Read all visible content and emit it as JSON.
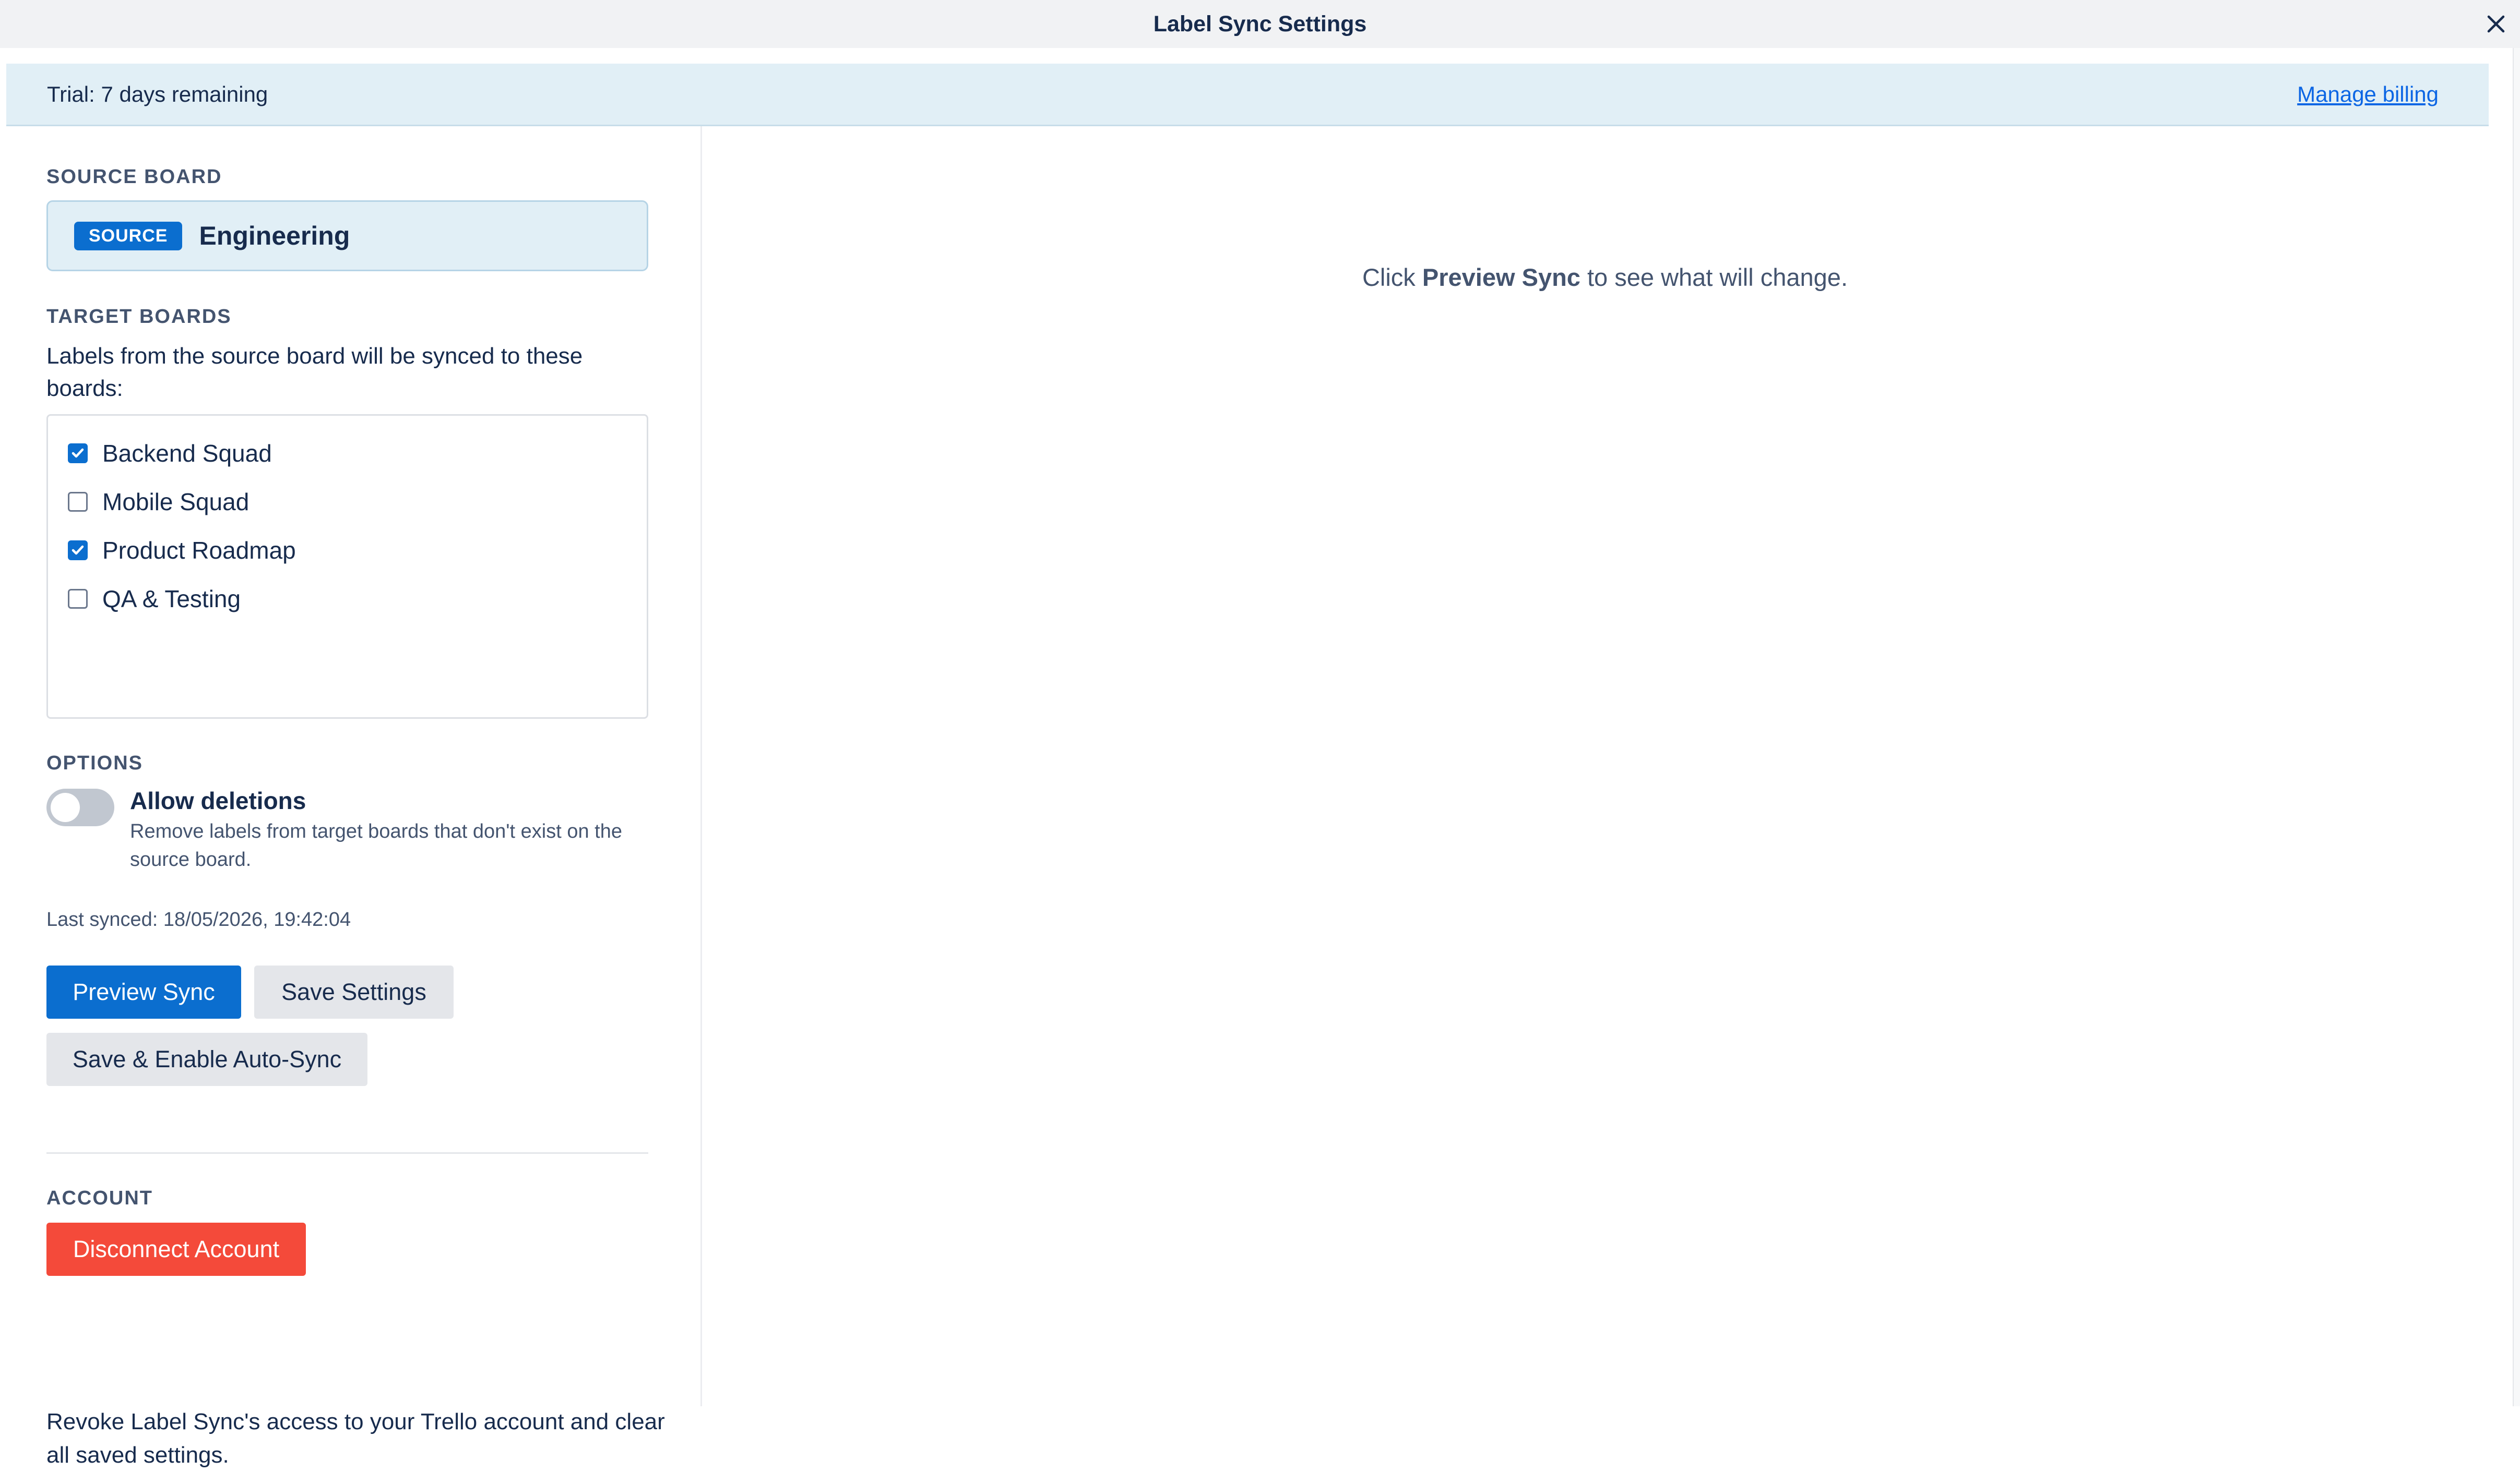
{
  "window": {
    "title": "Label Sync Settings",
    "close_icon": "close-icon"
  },
  "trial_banner": {
    "text": "Trial: 7 days remaining",
    "manage_billing_label": "Manage billing"
  },
  "source_board": {
    "section_label": "SOURCE BOARD",
    "badge": "SOURCE",
    "name": "Engineering"
  },
  "target_boards": {
    "section_label": "TARGET BOARDS",
    "help_text": "Labels from the source board will be synced to these boards:",
    "boards": [
      {
        "label": "Backend Squad",
        "checked": true
      },
      {
        "label": "Mobile Squad",
        "checked": false
      },
      {
        "label": "Product Roadmap",
        "checked": true
      },
      {
        "label": "QA & Testing",
        "checked": false
      }
    ]
  },
  "options": {
    "section_label": "OPTIONS",
    "allow_deletions": {
      "title": "Allow deletions",
      "description": "Remove labels from target boards that don't exist on the source board.",
      "enabled": false
    }
  },
  "last_synced": "Last synced: 18/05/2026, 19:42:04",
  "actions": {
    "preview_sync": "Preview Sync",
    "save_settings": "Save Settings",
    "save_enable_auto_sync": "Save & Enable Auto-Sync"
  },
  "account": {
    "section_label": "ACCOUNT",
    "disconnect_label": "Disconnect Account",
    "description": "Revoke Label Sync's access to your Trello account and clear all saved settings."
  },
  "preview": {
    "prefix": "Click ",
    "action_name": "Preview Sync",
    "suffix": " to see what will change."
  },
  "colors": {
    "primary": "#0b6ecf",
    "danger": "#f44a3a",
    "banner_background": "#e1eff6",
    "link": "#0c66e4"
  }
}
